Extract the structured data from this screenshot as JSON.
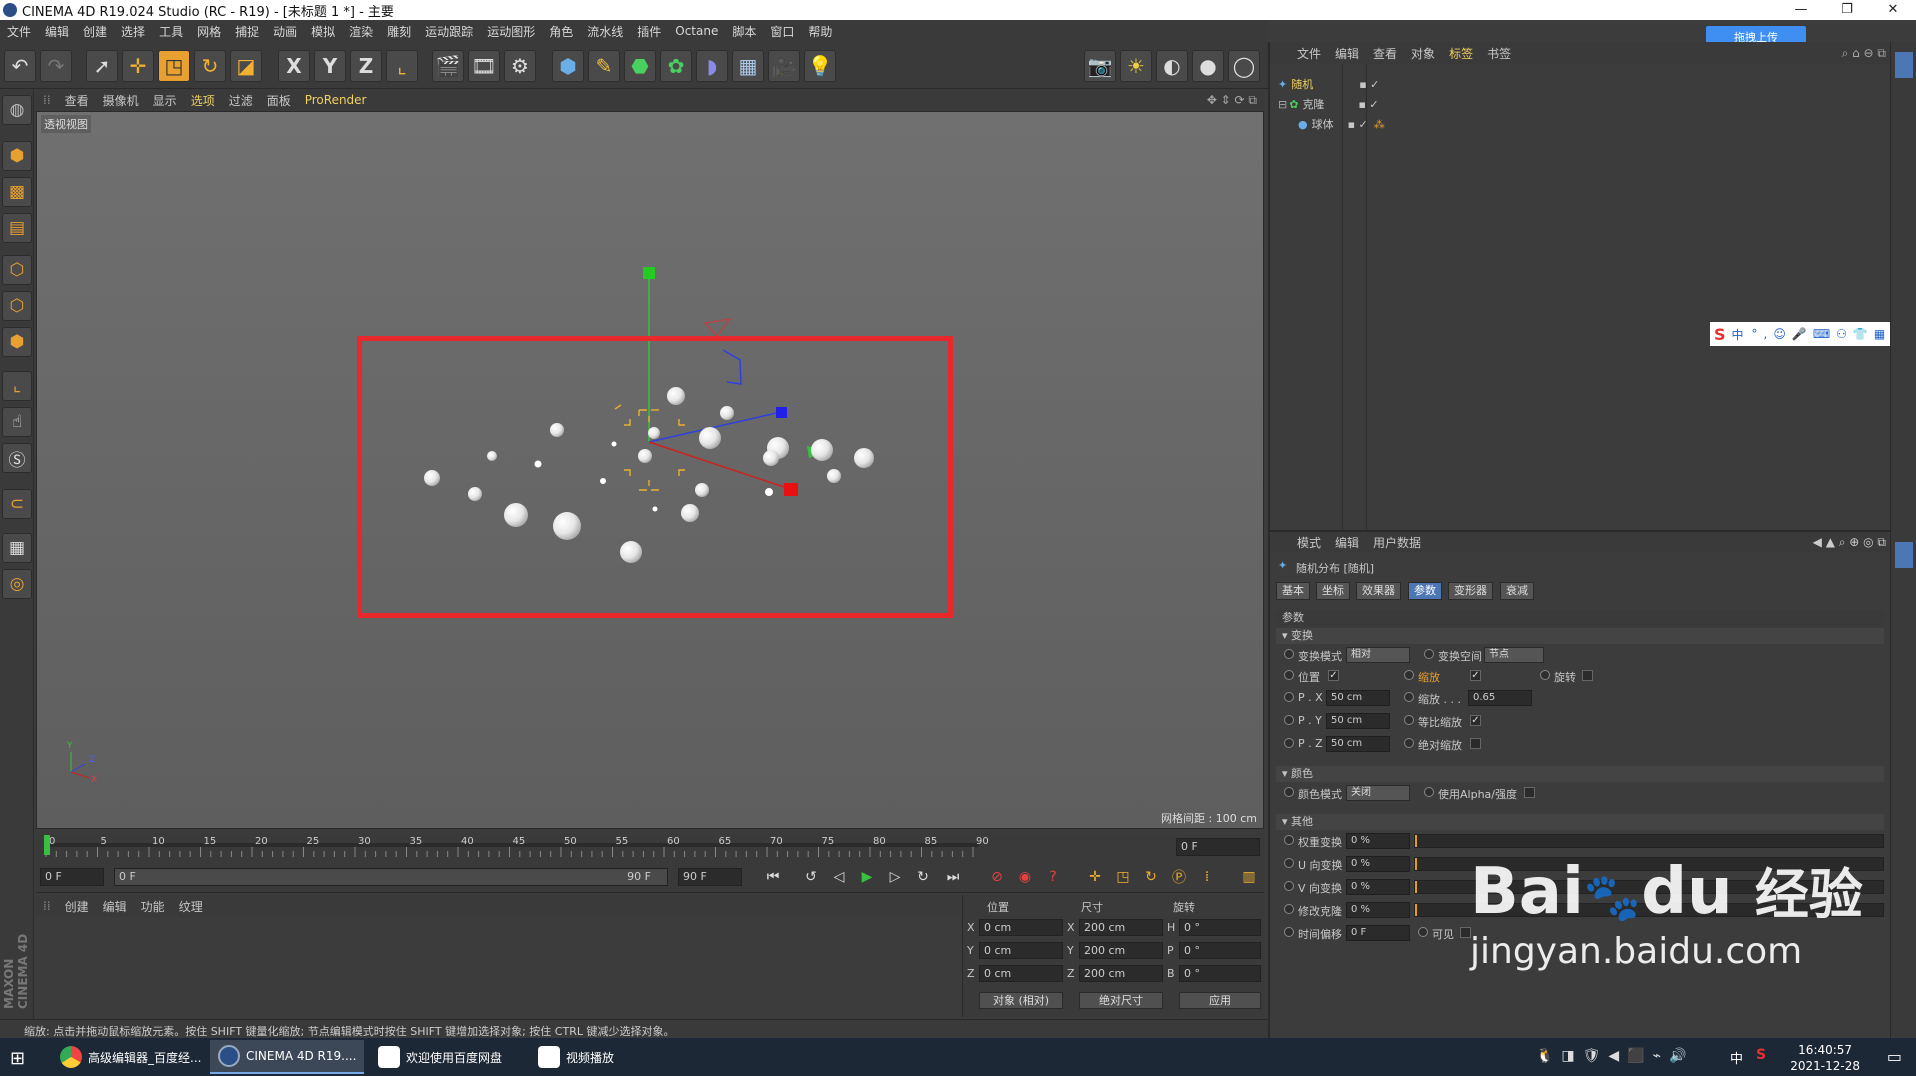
{
  "window": {
    "title": "CINEMA 4D R19.024 Studio (RC - R19) - [未标题 1 *] - 主要"
  },
  "menu": [
    "文件",
    "编辑",
    "创建",
    "选择",
    "工具",
    "网格",
    "捕捉",
    "动画",
    "模拟",
    "渲染",
    "雕刻",
    "运动跟踪",
    "运动图形",
    "角色",
    "流水线",
    "插件",
    "Octane",
    "脚本",
    "窗口",
    "帮助"
  ],
  "toolbar": {
    "x_label": "X",
    "y_label": "Y",
    "z_label": "Z"
  },
  "viewport_menu": [
    "查看",
    "摄像机",
    "显示",
    "选项",
    "过滤",
    "面板",
    "ProRender"
  ],
  "viewport": {
    "name": "透视视图",
    "grid_info": "网格间距 : 100 cm"
  },
  "timeline": {
    "ticks": [
      "0",
      "5",
      "10",
      "15",
      "20",
      "25",
      "30",
      "35",
      "40",
      "45",
      "50",
      "55",
      "60",
      "65",
      "70",
      "75",
      "80",
      "85",
      "90"
    ],
    "end_field": "0 F"
  },
  "transport": {
    "start": "0 F",
    "range_start": "0 F",
    "range_end": "90 F",
    "end": "90 F"
  },
  "material_menu": [
    "创建",
    "编辑",
    "功能",
    "纹理"
  ],
  "coords": {
    "headers": [
      "位置",
      "尺寸",
      "旋转"
    ],
    "rows": [
      {
        "axis": "X",
        "pos": "0 cm",
        "size_axis": "X",
        "size": "200 cm",
        "rot_axis": "H",
        "rot": "0 °"
      },
      {
        "axis": "Y",
        "pos": "0 cm",
        "size_axis": "Y",
        "size": "200 cm",
        "rot_axis": "P",
        "rot": "0 °"
      },
      {
        "axis": "Z",
        "pos": "0 cm",
        "size_axis": "Z",
        "size": "200 cm",
        "rot_axis": "B",
        "rot": "0 °"
      }
    ],
    "mode_dropdown": "对象 (相对)",
    "size_dropdown": "绝对尺寸",
    "apply": "应用"
  },
  "status": "缩放: 点击并拖动鼠标缩放元素。按住 SHIFT 键量化缩放; 节点编辑模式时按住 SHIFT 键增加选择对象; 按住 CTRL 键减少选择对象。",
  "object_manager": {
    "menu": [
      "文件",
      "编辑",
      "查看",
      "对象",
      "标签",
      "书签"
    ],
    "objects": [
      "随机",
      "克隆",
      "球体"
    ]
  },
  "attributes": {
    "menu": [
      "模式",
      "编辑",
      "用户数据"
    ],
    "title": "随机分布 [随机]",
    "tabs": [
      "基本",
      "坐标",
      "效果器",
      "参数",
      "变形器",
      "衰减"
    ],
    "section_params": "参数",
    "sec_transform": "变换",
    "transform_mode_label": "变换模式",
    "transform_mode": "相对",
    "transform_space_label": "变换空间",
    "transform_space": "节点",
    "position_label": "位置",
    "scale_label": "缩放",
    "rotation_label": "旋转",
    "px_label": "P . X",
    "px": "50 cm",
    "py_label": "P . Y",
    "py": "50 cm",
    "pz_label": "P . Z",
    "pz": "50 cm",
    "scale_value_label": "缩放 . . .",
    "scale_value": "0.65",
    "uniform_label": "等比缩放",
    "absolute_label": "绝对缩放",
    "sec_color": "颜色",
    "color_mode_label": "颜色模式",
    "color_mode": "关闭",
    "use_alpha_label": "使用Alpha/强度",
    "sec_other": "其他",
    "weight_label": "权重变换",
    "weight": "0 %",
    "u_label": "U 向变换",
    "u": "0 %",
    "v_label": "V 向变换",
    "v": "0 %",
    "modclone_label": "修改克隆",
    "modclone": "0 %",
    "timeoffset_label": "时间偏移",
    "timeoffset": "0 F",
    "visible_label": "可见"
  },
  "upload_button": "拖拽上传",
  "ime": {
    "lang": "中"
  },
  "taskbar": {
    "apps": [
      "高级编辑器_百度经...",
      "CINEMA 4D R19....",
      "欢迎使用百度网盘",
      "视频播放"
    ],
    "time": "16:40:57",
    "date": "2021-12-28",
    "ime": "中"
  },
  "brand": {
    "maxon": "MAXON",
    "cinema": "CINEMA 4D"
  },
  "watermark": {
    "logo": "Bai",
    "logo2": "du",
    "cn": "经验",
    "url": "jingyan.baidu.com"
  },
  "colors": {
    "selection_box": "#e8282a",
    "active_tab": "#4d76b4",
    "taskbar": "#1d2836"
  }
}
